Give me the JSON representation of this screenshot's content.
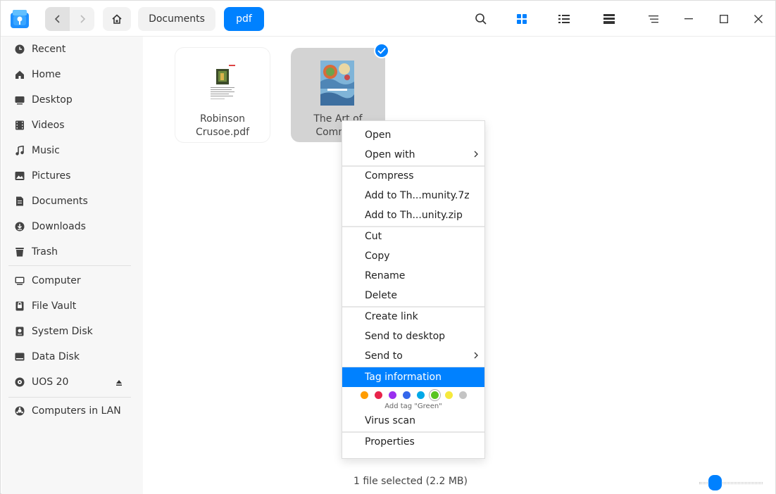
{
  "titlebar": {
    "breadcrumbs": [
      "Documents",
      "pdf"
    ],
    "icons": [
      "search-icon",
      "icon-view-icon",
      "list-view-icon",
      "details-view-icon",
      "menu-icon",
      "minimize-icon",
      "maximize-icon",
      "close-icon"
    ]
  },
  "sidebar": {
    "items": [
      {
        "label": "Recent",
        "icon": "clock-icon"
      },
      {
        "label": "Home",
        "icon": "home-icon"
      },
      {
        "label": "Desktop",
        "icon": "desktop-icon"
      },
      {
        "label": "Videos",
        "icon": "video-icon"
      },
      {
        "label": "Music",
        "icon": "music-icon"
      },
      {
        "label": "Pictures",
        "icon": "picture-icon"
      },
      {
        "label": "Documents",
        "icon": "document-icon"
      },
      {
        "label": "Downloads",
        "icon": "download-icon"
      },
      {
        "label": "Trash",
        "icon": "trash-icon"
      }
    ],
    "devices": [
      {
        "label": "Computer",
        "icon": "computer-icon"
      },
      {
        "label": "File Vault",
        "icon": "lock-icon"
      },
      {
        "label": "System Disk",
        "icon": "disk-icon"
      },
      {
        "label": "Data Disk",
        "icon": "disk-icon"
      },
      {
        "label": "UOS 20",
        "icon": "optical-disc-icon"
      }
    ],
    "network": [
      {
        "label": "Computers in LAN",
        "icon": "network-icon"
      }
    ]
  },
  "files": [
    {
      "name_line1": "Robinson",
      "name_line2": "Crusoe.pdf",
      "selected": false
    },
    {
      "name_line1": "The Art of",
      "name_line2": "Commun",
      "selected": true
    }
  ],
  "context_menu": {
    "items": [
      "Open",
      "Open with",
      "Compress",
      "Add to Th...munity.7z",
      "Add to Th...unity.zip",
      "Cut",
      "Copy",
      "Rename",
      "Delete",
      "Create link",
      "Send to desktop",
      "Send to",
      "Tag information",
      "Virus scan",
      "Properties"
    ],
    "tag_colors": [
      "#ff9c00",
      "#e8244b",
      "#9a2fef",
      "#3467eb",
      "#00a8e8",
      "#58c420",
      "#f6e93d",
      "#c4c4c4"
    ],
    "tag_hint": "Add tag \"Green\"",
    "highlighted": "Tag information"
  },
  "status": {
    "text": "1 file selected (2.2 MB)"
  },
  "colors": {
    "accent": "#0081ff",
    "sidebar_bg": "#f7f7f7"
  }
}
